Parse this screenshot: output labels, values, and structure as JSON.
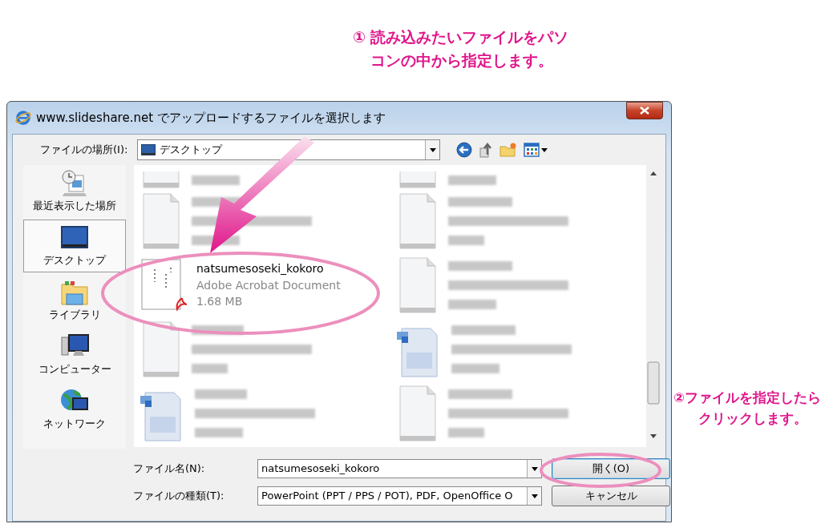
{
  "annotations": [
    {
      "number": "①",
      "lines": [
        "読み込みたいファイルをパソ",
        "コンの中から指定します。"
      ]
    },
    {
      "number": "②",
      "lines": [
        "ファイルを指定したら",
        "クリックします。"
      ]
    }
  ],
  "window": {
    "title": "www.slideshare.net でアップロードするファイルを選択します"
  },
  "location": {
    "label": "ファイルの場所(I):",
    "value": "デスクトップ"
  },
  "places": [
    {
      "label": "最近表示した場所",
      "kind": "recent",
      "selected": false
    },
    {
      "label": "デスクトップ",
      "kind": "desktop",
      "selected": true
    },
    {
      "label": "ライブラリ",
      "kind": "library",
      "selected": false
    },
    {
      "label": "コンピューター",
      "kind": "computer",
      "selected": false
    },
    {
      "label": "ネットワーク",
      "kind": "network",
      "selected": false
    }
  ],
  "files": [
    {
      "kind": "partial"
    },
    {
      "kind": "partial"
    },
    {
      "kind": "document"
    },
    {
      "kind": "document"
    },
    {
      "kind": "pdf",
      "name": "natsumesoseki_kokoro",
      "type": "Adobe Acrobat Document",
      "size": "1.68 MB"
    },
    {
      "kind": "document"
    },
    {
      "kind": "document"
    },
    {
      "kind": "word"
    },
    {
      "kind": "word"
    },
    {
      "kind": "document"
    }
  ],
  "file_name": {
    "label": "ファイル名(N):",
    "value": "natsumesoseki_kokoro"
  },
  "file_type": {
    "label": "ファイルの種類(T):",
    "value": "PowerPoint (PPT / PPS / POT), PDF, OpenOffice O"
  },
  "buttons": [
    {
      "label": "開く(O)",
      "kind": "default"
    },
    {
      "label": "キャンセル",
      "kind": "normal"
    }
  ]
}
